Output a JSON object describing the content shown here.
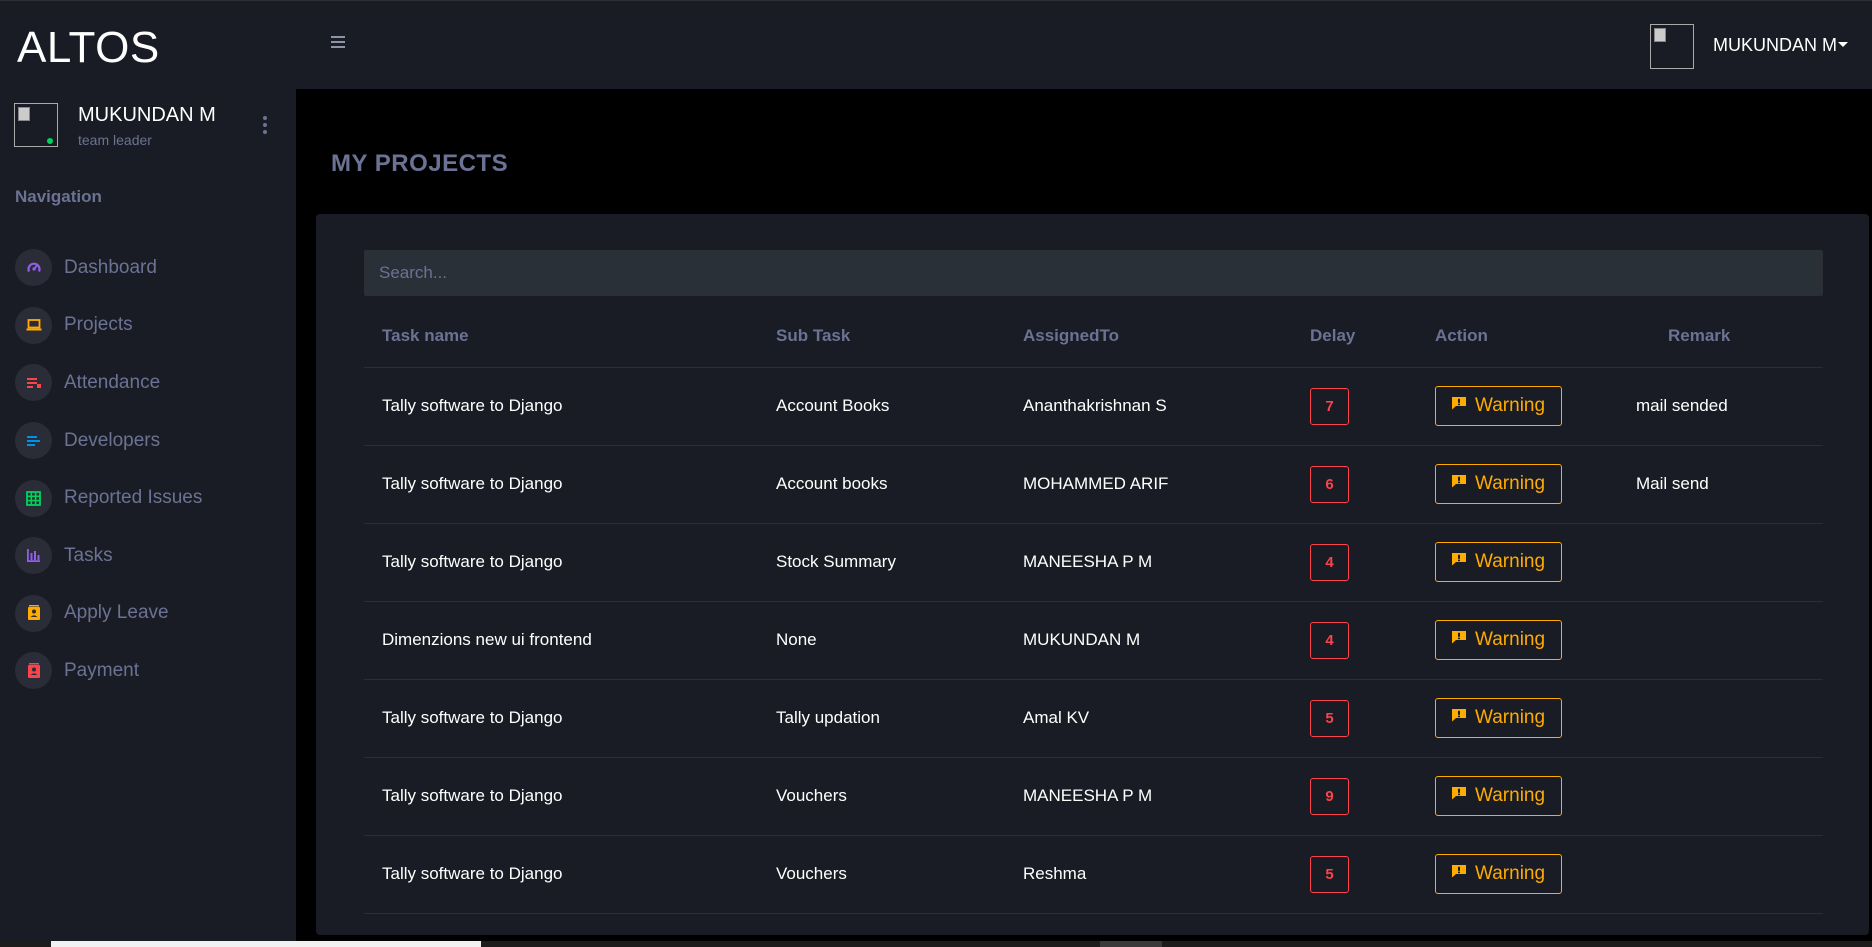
{
  "app": {
    "brand": "ALTOS"
  },
  "sidebar": {
    "user_name": "MUKUNDAN M",
    "user_role": "team leader",
    "nav_heading": "Navigation",
    "items": [
      {
        "label": "Dashboard",
        "icon": "speedometer-icon",
        "color": "#8f5fe8"
      },
      {
        "label": "Projects",
        "icon": "laptop-icon",
        "color": "#ffab00"
      },
      {
        "label": "Attendance",
        "icon": "playlist-icon",
        "color": "#fc424a"
      },
      {
        "label": "Developers",
        "icon": "list-icon",
        "color": "#0090e7"
      },
      {
        "label": "Reported Issues",
        "icon": "table-icon",
        "color": "#00d25b"
      },
      {
        "label": "Tasks",
        "icon": "chart-bar-icon",
        "color": "#8f5fe8"
      },
      {
        "label": "Apply Leave",
        "icon": "contacts-icon",
        "color": "#ffab00"
      },
      {
        "label": "Payment",
        "icon": "contacts-icon",
        "color": "#fc424a"
      }
    ]
  },
  "topbar": {
    "user_name": "MUKUNDAN M"
  },
  "main": {
    "page_title": "MY PROJECTS",
    "search_placeholder": "Search...",
    "columns": [
      "Task name",
      "Sub Task",
      "AssignedTo",
      "Delay",
      "Action",
      "Remark"
    ],
    "rows": [
      {
        "task": "Tally software to Django",
        "subtask": "Account Books",
        "assigned": "Ananthakrishnan S",
        "delay": "7",
        "action": "Warning",
        "remark": "mail sended"
      },
      {
        "task": "Tally software to Django",
        "subtask": "Account books",
        "assigned": "MOHAMMED ARIF",
        "delay": "6",
        "action": "Warning",
        "remark": "Mail send"
      },
      {
        "task": "Tally software to Django",
        "subtask": "Stock Summary",
        "assigned": "MANEESHA P M",
        "delay": "4",
        "action": "Warning",
        "remark": ""
      },
      {
        "task": "Dimenzions new ui frontend",
        "subtask": "None",
        "assigned": "MUKUNDAN M",
        "delay": "4",
        "action": "Warning",
        "remark": ""
      },
      {
        "task": "Tally software to Django",
        "subtask": "Tally updation",
        "assigned": "Amal KV",
        "delay": "5",
        "action": "Warning",
        "remark": ""
      },
      {
        "task": "Tally software to Django",
        "subtask": "Vouchers",
        "assigned": "MANEESHA P M",
        "delay": "9",
        "action": "Warning",
        "remark": ""
      },
      {
        "task": "Tally software to Django",
        "subtask": "Vouchers",
        "assigned": "Reshma",
        "delay": "5",
        "action": "Warning",
        "remark": ""
      }
    ]
  },
  "colors": {
    "sidebar_bg": "#191c24",
    "page_bg": "#000000",
    "muted_text": "#6c7293",
    "danger": "#fc424a",
    "warning": "#ffab00"
  }
}
